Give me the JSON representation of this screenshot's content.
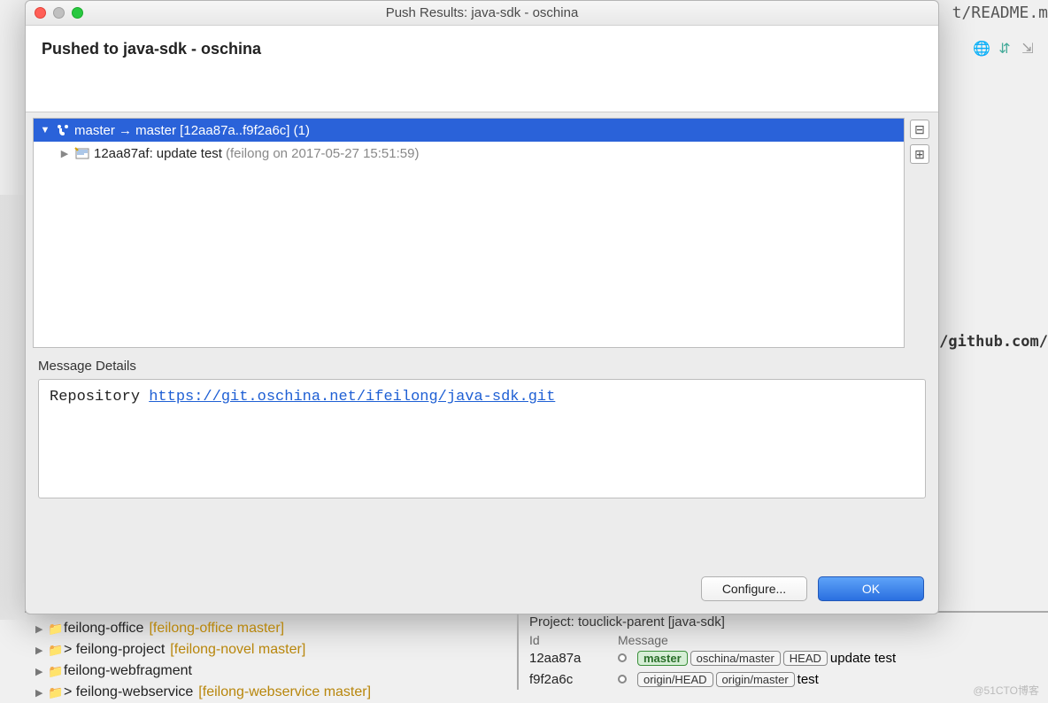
{
  "titlebar": {
    "title": "Push Results: java-sdk - oschina"
  },
  "header": {
    "title": "Pushed to java-sdk - oschina"
  },
  "tree": {
    "branch_line": "master → master [12aa87a..f9f2a6c] (1)",
    "commit_hash": "12aa87af:",
    "commit_msg": "update test",
    "commit_meta": "(feilong on 2017-05-27 15:51:59)"
  },
  "details": {
    "label": "Message Details",
    "prefix": "Repository ",
    "url": "https://git.oschina.net/ifeilong/java-sdk.git"
  },
  "buttons": {
    "configure": "Configure...",
    "ok": "OK"
  },
  "bg": {
    "readme": "t/README.m",
    "github": "/github.com/",
    "projects": [
      {
        "name": "feilong-office",
        "branch": "[feilong-office master]",
        "dirty": true
      },
      {
        "name": "> feilong-project",
        "branch": "[feilong-novel master]",
        "dirty": true
      },
      {
        "name": "feilong-webfragment",
        "branch": "",
        "dirty": false
      },
      {
        "name": "> feilong-webservice",
        "branch": "[feilong-webservice master]",
        "dirty": true
      }
    ]
  },
  "commits": {
    "title": "Project: touclick-parent [java-sdk]",
    "col_id": "Id",
    "col_msg": "Message",
    "rows": [
      {
        "id": "12aa87a",
        "refs": [
          "master",
          "oschina/master",
          "HEAD"
        ],
        "msg": "update test"
      },
      {
        "id": "f9f2a6c",
        "refs": [
          "origin/HEAD",
          "origin/master"
        ],
        "msg": "test"
      }
    ]
  },
  "watermark": "@51CTO博客"
}
